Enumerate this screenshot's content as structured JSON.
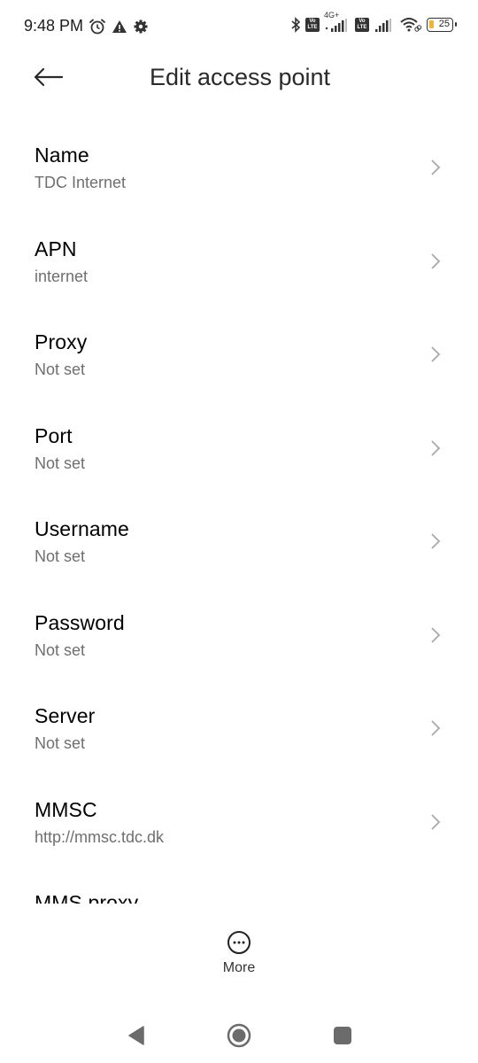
{
  "status_bar": {
    "time": "9:48 PM",
    "left_icons": [
      "alarm-icon",
      "warning-icon",
      "settings-gear-icon"
    ],
    "right_icons": [
      "bluetooth-icon",
      "volte-icon",
      "signal-icon",
      "volte-icon",
      "signal-icon",
      "wifi-icon",
      "battery-icon"
    ],
    "network_type": "4G+",
    "volte_label": "Vo LTE",
    "battery_level": "25",
    "battery_color": "#f2b233"
  },
  "app_bar": {
    "back_icon": "arrow-left-icon",
    "title": "Edit access point"
  },
  "settings": [
    {
      "title": "Name",
      "value": "TDC Internet"
    },
    {
      "title": "APN",
      "value": "internet"
    },
    {
      "title": "Proxy",
      "value": "Not set"
    },
    {
      "title": "Port",
      "value": "Not set"
    },
    {
      "title": "Username",
      "value": "Not set"
    },
    {
      "title": "Password",
      "value": "Not set"
    },
    {
      "title": "Server",
      "value": "Not set"
    },
    {
      "title": "MMSC",
      "value": "http://mmsc.tdc.dk"
    },
    {
      "title": "MMS proxy",
      "value": ""
    }
  ],
  "bottom_action": {
    "more_label": "More",
    "more_icon": "more-horizontal-circle-icon"
  },
  "nav_bar": {
    "icons": [
      "nav-back-icon",
      "nav-home-icon",
      "nav-recents-icon"
    ],
    "color": "#6b6b6b"
  }
}
